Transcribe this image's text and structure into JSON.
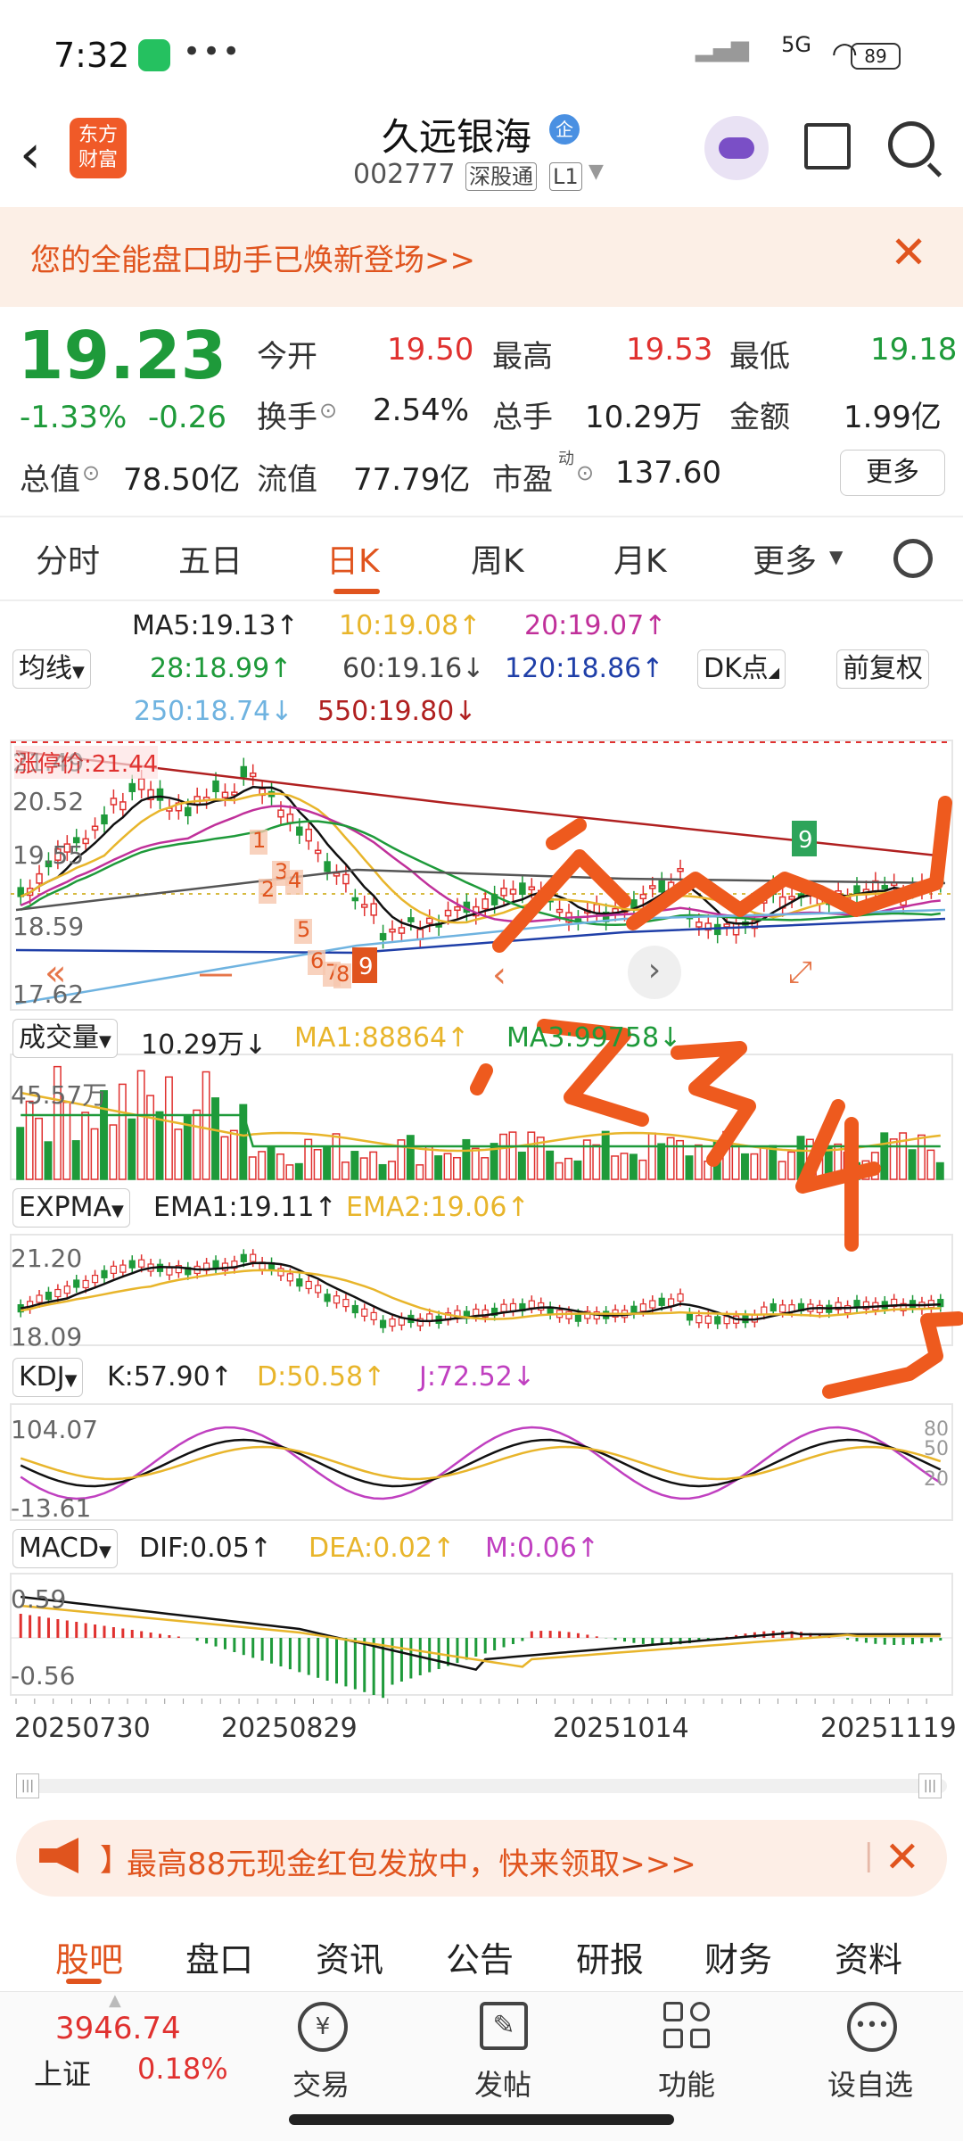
{
  "status": {
    "time": "7:32",
    "signal_5g": "5G",
    "battery": "89"
  },
  "header": {
    "logo_text": "东方财富",
    "stock_name": "久远银海",
    "badge": "企",
    "code": "002777",
    "tag1": "深股通",
    "tag2": "L1"
  },
  "banner": {
    "text": "您的全能盘口助手已焕新登场>>"
  },
  "quote": {
    "price": "19.23",
    "pct": "-1.33%",
    "change": "-0.26",
    "open_label": "今开",
    "open": "19.50",
    "high_label": "最高",
    "high": "19.53",
    "low_label": "最低",
    "low": "19.18",
    "turnover_label": "换手",
    "turnover": "2.54%",
    "vol_label": "总手",
    "vol": "10.29万",
    "amount_label": "金额",
    "amount": "1.99亿",
    "mcap_label": "总值",
    "mcap": "78.50亿",
    "float_label": "流值",
    "float": "77.79亿",
    "pe_label": "市盈",
    "pe_sup": "动",
    "pe": "137.60",
    "more": "更多"
  },
  "tabs": [
    "分时",
    "五日",
    "日K",
    "周K",
    "月K",
    "更多"
  ],
  "active_tab": "日K",
  "ma": {
    "select": "均线",
    "ma5": "MA5:19.13↑",
    "ma10": "10:19.08↑",
    "ma20": "20:19.07↑",
    "ma28": "28:18.99↑",
    "ma60": "60:19.16↓",
    "ma120": "120:18.86↑",
    "ma250": "250:18.74↓",
    "ma550": "550:19.80↓",
    "dk": "DK点",
    "fq": "前复权"
  },
  "kchart": {
    "limit_label": "涨停价:21.44",
    "y_labels": [
      "21.49",
      "20.52",
      "19.55",
      "18.59",
      "17.62"
    ],
    "nine_up": "9",
    "nine_down": "9"
  },
  "volume": {
    "select": "成交量",
    "val": "10.29万↓",
    "ma1": "MA1:88864↑",
    "ma3": "MA3:99758↓",
    "ymax": "45.57万"
  },
  "expma": {
    "select": "EXPMA",
    "ema1": "EMA1:19.11↑",
    "ema2": "EMA2:19.06↑",
    "ymax": "21.20",
    "ymin": "18.09"
  },
  "kdj": {
    "select": "KDJ",
    "k": "K:57.90↑",
    "d": "D:50.58↑",
    "j": "J:72.52↓",
    "ymax": "104.07",
    "ymin": "-13.61",
    "r80": "80",
    "r50": "50",
    "r20": "20"
  },
  "macd": {
    "select": "MACD",
    "dif": "DIF:0.05↑",
    "dea": "DEA:0.02↑",
    "m": "M:0.06↑",
    "ymax": "0.59",
    "ymin": "-0.56"
  },
  "dates": [
    "20250730",
    "20250829",
    "20251014",
    "20251119"
  ],
  "handwriting": "1 2 3 4 5",
  "promo": {
    "text": "最高88元现金红包发放中，快来领取>>>"
  },
  "bottom_tabs": [
    "股吧",
    "盘口",
    "资讯",
    "公告",
    "研报",
    "财务",
    "资料"
  ],
  "bottom_bar": {
    "index_value": "3946.74",
    "index_name": "上证",
    "index_pct": "0.18%",
    "trade": "交易",
    "post": "发帖",
    "func": "功能",
    "watch": "设自选"
  },
  "colors": {
    "up": "#e0312f",
    "down": "#1e9a3a",
    "accent": "#e0541e"
  }
}
